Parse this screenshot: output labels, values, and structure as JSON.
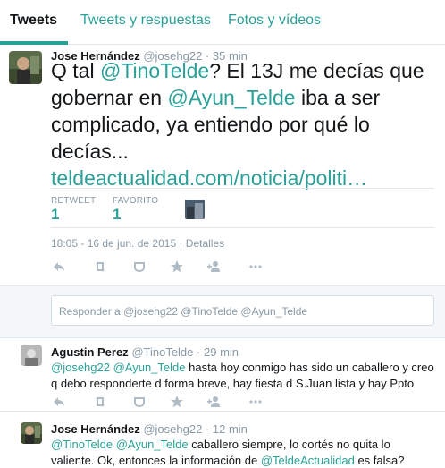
{
  "tabs": [
    {
      "label": "Tweets",
      "active": true
    },
    {
      "label": "Tweets y respuestas",
      "active": false
    },
    {
      "label": "Fotos y vídeos",
      "active": false
    }
  ],
  "main_tweet": {
    "author_name": "Jose Hernández",
    "handle": "@josehg22",
    "separator": "·",
    "time": "35 min",
    "text_parts": {
      "t1": "Q tal ",
      "m1": "@TinoTelde",
      "t2": "? El 13J me decías que gobernar en ",
      "m2": "@Ayun_Telde",
      "t3": " iba a ser complicado, ya entiendo por qué lo decías...",
      "link": "teldeactualidad.com/noticia/politi…"
    },
    "retweets_label": "RETWEET",
    "retweets_count": "1",
    "favorites_label": "FAVORITO",
    "favorites_count": "1",
    "timestamp": "18:05 - 16 de jun. de 2015 · Detalles"
  },
  "reply_box": {
    "placeholder": "Responder a @josehg22 @TinoTelde @Ayun_Telde"
  },
  "replies": [
    {
      "author_name": "Agustin Perez",
      "handle": "@TinoTelde",
      "separator": "·",
      "time": "29 min",
      "m1": "@josehg22",
      "space": " ",
      "m2": "@Ayun_Telde",
      "t1": " hasta hoy conmigo has sido un caballero y creo q debo responderte d forma breve, hay fiesta d S.Juan lista y hay Ppto"
    },
    {
      "author_name": "Jose Hernández",
      "handle": "@josehg22",
      "separator": "·",
      "time": "12 min",
      "m1": "@TinoTelde",
      "space": " ",
      "m2": "@Ayun_Telde",
      "t1": " caballero siempre, lo cortés no quita lo valiente. Ok, entonces la información de ",
      "m3": "@TeldeActualidad",
      "t2": " es falsa?"
    }
  ],
  "colors": {
    "accent": "#2aa198",
    "muted": "#8899a6",
    "text": "#14171a",
    "border": "#e1e8ed"
  },
  "icons": [
    "reply-icon",
    "retweet-icon",
    "favorite-icon",
    "star-icon",
    "follow-icon",
    "more-icon"
  ]
}
